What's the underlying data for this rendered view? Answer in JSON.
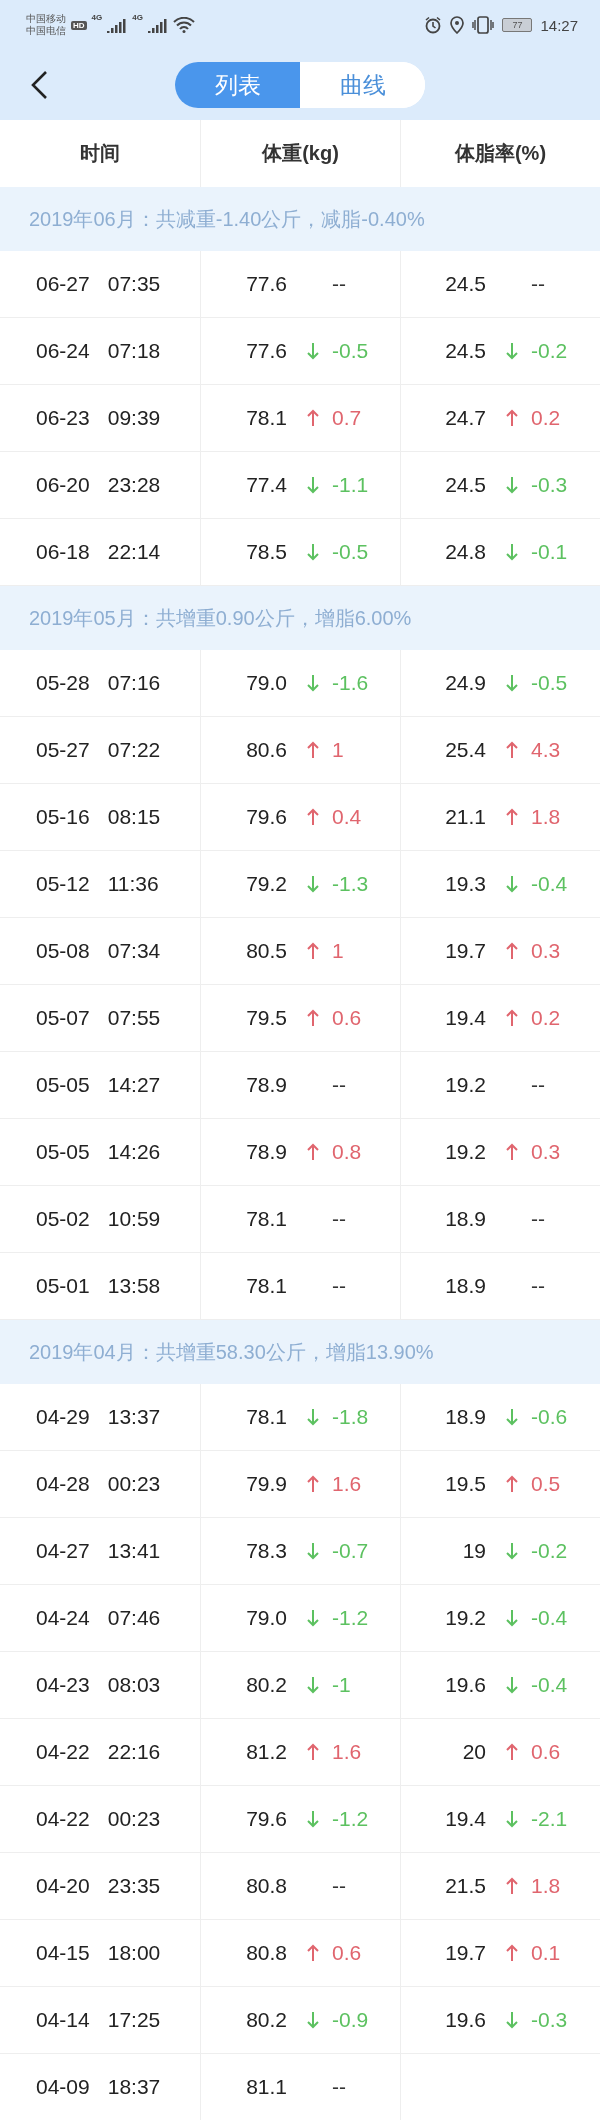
{
  "status_bar": {
    "carriers": [
      "中国移动",
      "中国电信"
    ],
    "hd_badge": "HD",
    "networks": [
      "4G",
      "4G"
    ],
    "battery": "77",
    "time": "14:27"
  },
  "tabs": [
    {
      "label": "列表",
      "selected": true
    },
    {
      "label": "曲线",
      "selected": false
    }
  ],
  "table": {
    "columns": [
      "时间",
      "体重(kg)",
      "体脂率(%)"
    ],
    "groups": [
      {
        "title": "2019年06月：共减重-1.40公斤，减脂-0.40%",
        "rows": [
          {
            "date": "06-27",
            "time": "07:35",
            "weight": {
              "value": "77.6",
              "kind": "none",
              "change": "--"
            },
            "fat": {
              "value": "24.5",
              "kind": "none",
              "change": "--"
            }
          },
          {
            "date": "06-24",
            "time": "07:18",
            "weight": {
              "value": "77.6",
              "kind": "down",
              "change": "-0.5"
            },
            "fat": {
              "value": "24.5",
              "kind": "down",
              "change": "-0.2"
            }
          },
          {
            "date": "06-23",
            "time": "09:39",
            "weight": {
              "value": "78.1",
              "kind": "up",
              "change": "0.7"
            },
            "fat": {
              "value": "24.7",
              "kind": "up",
              "change": "0.2"
            }
          },
          {
            "date": "06-20",
            "time": "23:28",
            "weight": {
              "value": "77.4",
              "kind": "down",
              "change": "-1.1"
            },
            "fat": {
              "value": "24.5",
              "kind": "down",
              "change": "-0.3"
            }
          },
          {
            "date": "06-18",
            "time": "22:14",
            "weight": {
              "value": "78.5",
              "kind": "down",
              "change": "-0.5"
            },
            "fat": {
              "value": "24.8",
              "kind": "down",
              "change": "-0.1"
            }
          }
        ]
      },
      {
        "title": "2019年05月：共增重0.90公斤，增脂6.00%",
        "rows": [
          {
            "date": "05-28",
            "time": "07:16",
            "weight": {
              "value": "79.0",
              "kind": "down",
              "change": "-1.6"
            },
            "fat": {
              "value": "24.9",
              "kind": "down",
              "change": "-0.5"
            }
          },
          {
            "date": "05-27",
            "time": "07:22",
            "weight": {
              "value": "80.6",
              "kind": "up",
              "change": "1"
            },
            "fat": {
              "value": "25.4",
              "kind": "up",
              "change": "4.3"
            }
          },
          {
            "date": "05-16",
            "time": "08:15",
            "weight": {
              "value": "79.6",
              "kind": "up",
              "change": "0.4"
            },
            "fat": {
              "value": "21.1",
              "kind": "up",
              "change": "1.8"
            }
          },
          {
            "date": "05-12",
            "time": "11:36",
            "weight": {
              "value": "79.2",
              "kind": "down",
              "change": "-1.3"
            },
            "fat": {
              "value": "19.3",
              "kind": "down",
              "change": "-0.4"
            }
          },
          {
            "date": "05-08",
            "time": "07:34",
            "weight": {
              "value": "80.5",
              "kind": "up",
              "change": "1"
            },
            "fat": {
              "value": "19.7",
              "kind": "up",
              "change": "0.3"
            }
          },
          {
            "date": "05-07",
            "time": "07:55",
            "weight": {
              "value": "79.5",
              "kind": "up",
              "change": "0.6"
            },
            "fat": {
              "value": "19.4",
              "kind": "up",
              "change": "0.2"
            }
          },
          {
            "date": "05-05",
            "time": "14:27",
            "weight": {
              "value": "78.9",
              "kind": "none",
              "change": "--"
            },
            "fat": {
              "value": "19.2",
              "kind": "none",
              "change": "--"
            }
          },
          {
            "date": "05-05",
            "time": "14:26",
            "weight": {
              "value": "78.9",
              "kind": "up",
              "change": "0.8"
            },
            "fat": {
              "value": "19.2",
              "kind": "up",
              "change": "0.3"
            }
          },
          {
            "date": "05-02",
            "time": "10:59",
            "weight": {
              "value": "78.1",
              "kind": "none",
              "change": "--"
            },
            "fat": {
              "value": "18.9",
              "kind": "none",
              "change": "--"
            }
          },
          {
            "date": "05-01",
            "time": "13:58",
            "weight": {
              "value": "78.1",
              "kind": "none",
              "change": "--"
            },
            "fat": {
              "value": "18.9",
              "kind": "none",
              "change": "--"
            }
          }
        ]
      },
      {
        "title": "2019年04月：共增重58.30公斤，增脂13.90%",
        "rows": [
          {
            "date": "04-29",
            "time": "13:37",
            "weight": {
              "value": "78.1",
              "kind": "down",
              "change": "-1.8"
            },
            "fat": {
              "value": "18.9",
              "kind": "down",
              "change": "-0.6"
            }
          },
          {
            "date": "04-28",
            "time": "00:23",
            "weight": {
              "value": "79.9",
              "kind": "up",
              "change": "1.6"
            },
            "fat": {
              "value": "19.5",
              "kind": "up",
              "change": "0.5"
            }
          },
          {
            "date": "04-27",
            "time": "13:41",
            "weight": {
              "value": "78.3",
              "kind": "down",
              "change": "-0.7"
            },
            "fat": {
              "value": "19",
              "kind": "down",
              "change": "-0.2"
            }
          },
          {
            "date": "04-24",
            "time": "07:46",
            "weight": {
              "value": "79.0",
              "kind": "down",
              "change": "-1.2"
            },
            "fat": {
              "value": "19.2",
              "kind": "down",
              "change": "-0.4"
            }
          },
          {
            "date": "04-23",
            "time": "08:03",
            "weight": {
              "value": "80.2",
              "kind": "down",
              "change": "-1"
            },
            "fat": {
              "value": "19.6",
              "kind": "down",
              "change": "-0.4"
            }
          },
          {
            "date": "04-22",
            "time": "22:16",
            "weight": {
              "value": "81.2",
              "kind": "up",
              "change": "1.6"
            },
            "fat": {
              "value": "20",
              "kind": "up",
              "change": "0.6"
            }
          },
          {
            "date": "04-22",
            "time": "00:23",
            "weight": {
              "value": "79.6",
              "kind": "down",
              "change": "-1.2"
            },
            "fat": {
              "value": "19.4",
              "kind": "down",
              "change": "-2.1"
            }
          },
          {
            "date": "04-20",
            "time": "23:35",
            "weight": {
              "value": "80.8",
              "kind": "none",
              "change": "--"
            },
            "fat": {
              "value": "21.5",
              "kind": "up",
              "change": "1.8"
            }
          },
          {
            "date": "04-15",
            "time": "18:00",
            "weight": {
              "value": "80.8",
              "kind": "up",
              "change": "0.6"
            },
            "fat": {
              "value": "19.7",
              "kind": "up",
              "change": "0.1"
            }
          },
          {
            "date": "04-14",
            "time": "17:25",
            "weight": {
              "value": "80.2",
              "kind": "down",
              "change": "-0.9"
            },
            "fat": {
              "value": "19.6",
              "kind": "down",
              "change": "-0.3"
            }
          },
          {
            "date": "04-09",
            "time": "18:37",
            "weight": {
              "value": "81.1",
              "kind": "none",
              "change": "--"
            }
          }
        ]
      }
    ]
  }
}
